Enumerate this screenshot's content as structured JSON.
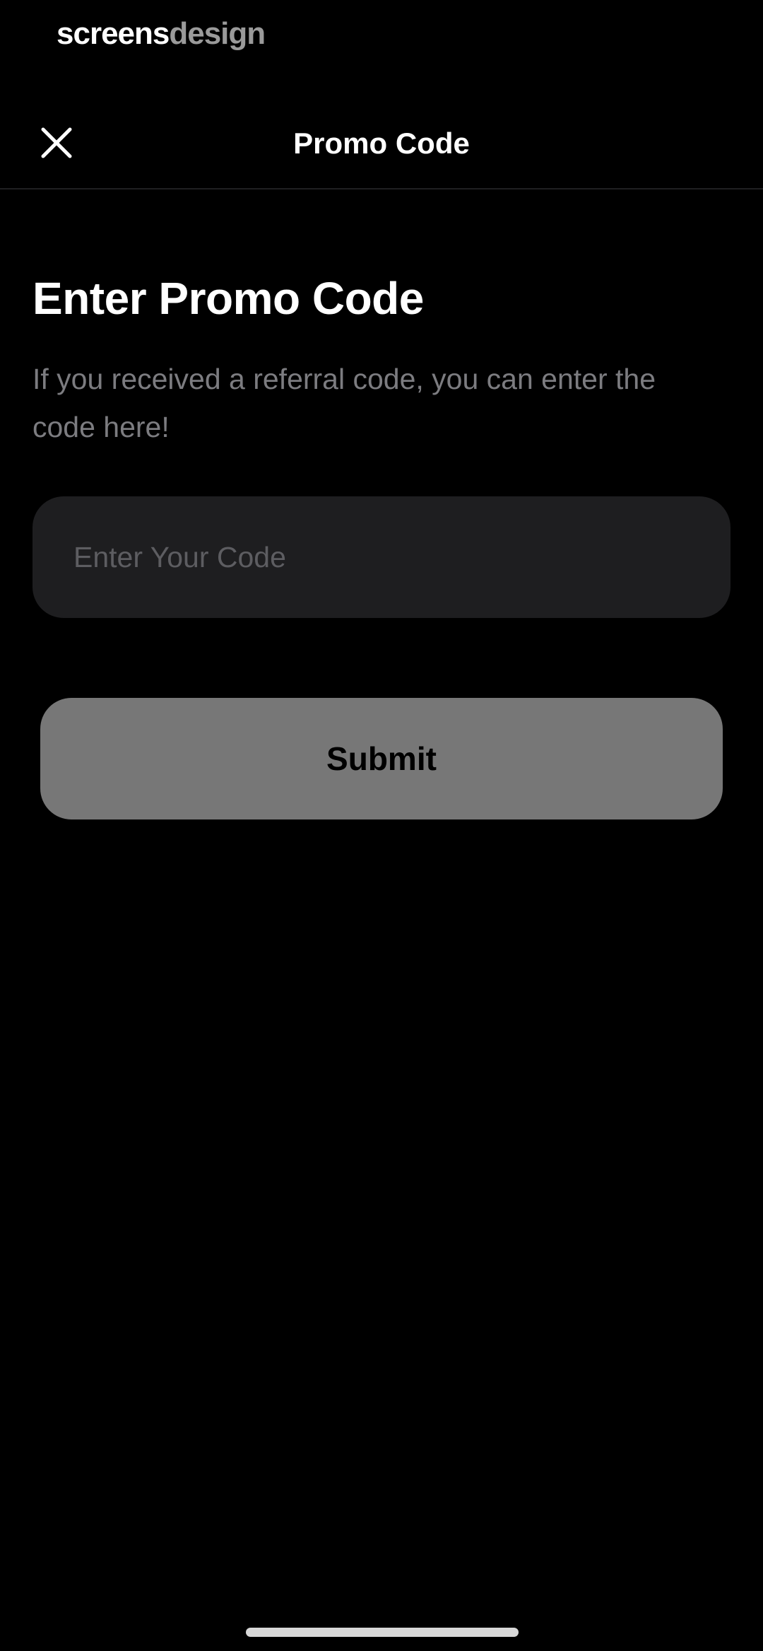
{
  "watermark": {
    "part1": "screens",
    "part2": "design"
  },
  "nav": {
    "title": "Promo Code",
    "close_icon": "close-icon"
  },
  "content": {
    "heading": "Enter Promo Code",
    "description": "If you received a referral code, you can enter the code here!"
  },
  "code_input": {
    "placeholder": "Enter Your Code",
    "value": ""
  },
  "submit": {
    "label": "Submit"
  },
  "colors": {
    "background": "#000000",
    "input_background": "#1e1e20",
    "button_background": "#777777",
    "secondary_text": "#7c7c80"
  }
}
